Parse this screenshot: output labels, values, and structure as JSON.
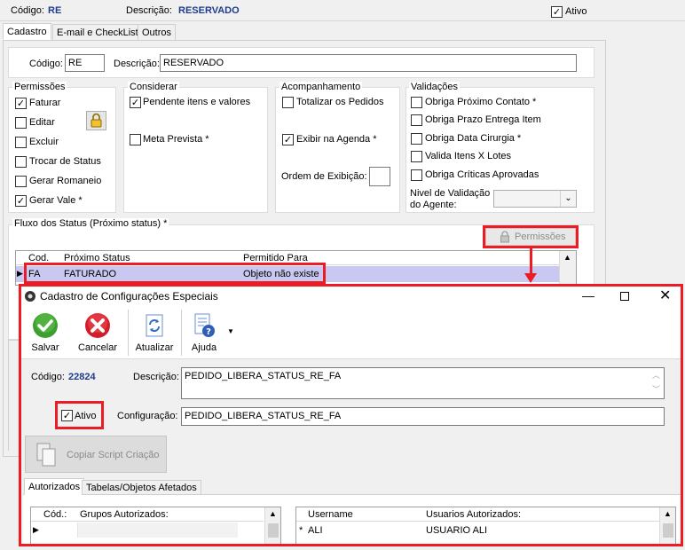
{
  "top": {
    "codigo_label": "Código:",
    "codigo_value": "RE",
    "descricao_label": "Descrição:",
    "descricao_value": "RESERVADO",
    "ativo_label": "Ativo",
    "ativo_checked": true
  },
  "tabs": [
    {
      "label": "Cadastro",
      "active": true
    },
    {
      "label": "E-mail e CheckList",
      "active": false
    },
    {
      "label": "Outros",
      "active": false
    }
  ],
  "form": {
    "codigo_label": "Código:",
    "codigo_value": "RE",
    "descricao_label": "Descrição:",
    "descricao_value": "RESERVADO"
  },
  "permissoes": {
    "title": "Permissões",
    "items": [
      {
        "label": "Faturar",
        "checked": true
      },
      {
        "label": "Editar",
        "checked": false
      },
      {
        "label": "Excluir",
        "checked": false
      },
      {
        "label": "Trocar de Status",
        "checked": false
      },
      {
        "label": "Gerar Romaneio",
        "checked": false
      },
      {
        "label": "Gerar Vale *",
        "checked": true
      }
    ]
  },
  "considerar": {
    "title": "Considerar",
    "items": [
      {
        "label": "Pendente itens e valores",
        "checked": true
      },
      {
        "label": "Meta Prevista *",
        "checked": false
      }
    ]
  },
  "acompanhamento": {
    "title": "Acompanhamento",
    "items": [
      {
        "label": "Totalizar os Pedidos",
        "checked": false
      },
      {
        "label": "Exibir na Agenda *",
        "checked": true
      }
    ],
    "ordem_label": "Ordem de Exibição:"
  },
  "validacoes": {
    "title": "Validações",
    "items": [
      {
        "label": "Obriga Próximo Contato *",
        "checked": false
      },
      {
        "label": "Obriga Prazo Entrega Item",
        "checked": false
      },
      {
        "label": "Obriga Data Cirurgia *",
        "checked": false
      },
      {
        "label": "Valida Itens X Lotes",
        "checked": false
      },
      {
        "label": "Obriga Críticas Aprovadas",
        "checked": false
      }
    ],
    "nivel_label_1": "Nivel de Validação",
    "nivel_label_2": "do Agente:"
  },
  "fluxo": {
    "title": "Fluxo dos Status (Próximo status) *",
    "permissoes_button": "Permissões",
    "columns": [
      "Cod.",
      "Próximo Status",
      "Permitido Para"
    ],
    "row": {
      "cod": "FA",
      "status": "FATURADO",
      "permitido": "Objeto não existe"
    }
  },
  "dialog": {
    "title": "Cadastro de Configurações Especiais",
    "toolbar": {
      "salvar": "Salvar",
      "cancelar": "Cancelar",
      "atualizar": "Atualizar",
      "ajuda": "Ajuda"
    },
    "codigo_label": "Código:",
    "codigo_value": "22824",
    "descricao_label": "Descrição:",
    "descricao_value": "PEDIDO_LIBERA_STATUS_RE_FA",
    "ativo_label": "Ativo",
    "ativo_checked": true,
    "configuracao_label": "Configuração:",
    "configuracao_value": "PEDIDO_LIBERA_STATUS_RE_FA",
    "copiar_button": "Copiar Script Criação",
    "tabs": [
      {
        "label": "Autorizados",
        "active": true
      },
      {
        "label": "Tabelas/Objetos Afetados",
        "active": false
      }
    ],
    "grupos_table": {
      "columns": [
        "Cód.:",
        "Grupos Autorizados:"
      ]
    },
    "usuarios_table": {
      "columns": [
        "Username",
        "Usuarios Autorizados:"
      ],
      "row": {
        "marker": "*",
        "username": "ALI",
        "nome": "USUARIO ALI"
      }
    }
  },
  "colors": {
    "highlight": "#ec1c24",
    "selected_row": "#c8c8f0",
    "code_blue": "#1f3d8c"
  }
}
